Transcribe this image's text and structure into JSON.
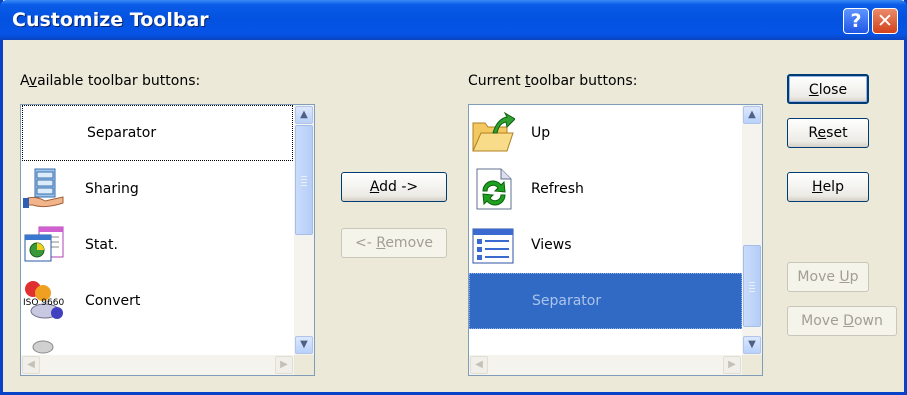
{
  "window": {
    "title": "Customize Toolbar",
    "help_glyph": "?",
    "close_glyph": "✕"
  },
  "available": {
    "label_pre": "A",
    "label_ul": "v",
    "label_post": "ailable toolbar buttons:",
    "items": [
      {
        "label": "Separator",
        "icon": "none"
      },
      {
        "label": "Sharing",
        "icon": "sharing-icon"
      },
      {
        "label": "Stat.",
        "icon": "statistics-icon"
      },
      {
        "label": "Convert",
        "icon": "iso9660-convert-icon",
        "icon_text": "ISO 9660"
      }
    ]
  },
  "current": {
    "label_pre": "Current ",
    "label_ul": "t",
    "label_post": "oolbar buttons:",
    "items": [
      {
        "label": "Up",
        "icon": "folder-up-icon"
      },
      {
        "label": "Refresh",
        "icon": "refresh-icon"
      },
      {
        "label": "Views",
        "icon": "views-icon"
      },
      {
        "label": "Separator",
        "icon": "none",
        "selected": true
      }
    ]
  },
  "buttons": {
    "add": {
      "ul": "A",
      "rest": "dd ->"
    },
    "remove": {
      "pre": "<- ",
      "ul": "R",
      "rest": "emove"
    },
    "close": {
      "ul": "C",
      "rest": "lose"
    },
    "reset": {
      "pre": "R",
      "ul": "e",
      "rest": "set"
    },
    "help": {
      "ul": "H",
      "rest": "elp"
    },
    "move_up": {
      "pre": "Move ",
      "ul": "U",
      "rest": "p"
    },
    "move_down": {
      "pre": "Move ",
      "ul": "D",
      "rest": "own"
    }
  },
  "colors": {
    "selection": "#316ac5",
    "focus_border": "#0a246a"
  }
}
